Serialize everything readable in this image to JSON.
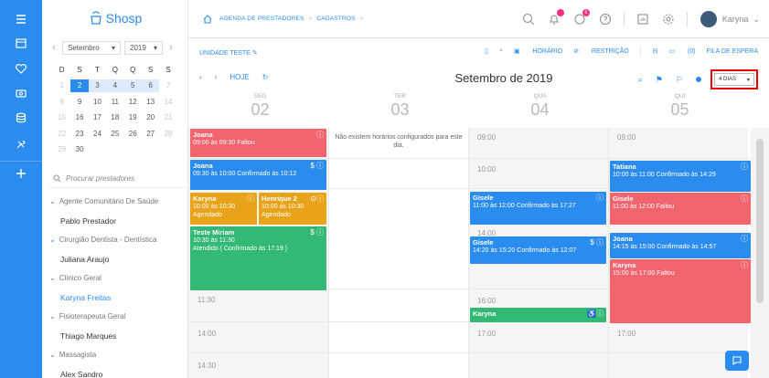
{
  "app": {
    "logo": "Shosp"
  },
  "breadcrumb": {
    "first": "AGENDA DE PRESTADORES",
    "second": "CADASTROS"
  },
  "header": {
    "notif_count": "",
    "msg_count": "6",
    "user_name": "Karyna"
  },
  "minical": {
    "month": "Setembro",
    "year": "2019",
    "weekdays": [
      "D",
      "S",
      "T",
      "Q",
      "Q",
      "S",
      "S"
    ],
    "weeks": [
      [
        "1",
        "2",
        "3",
        "4",
        "5",
        "6",
        "7"
      ],
      [
        "8",
        "9",
        "10",
        "11",
        "12",
        "13",
        "14"
      ],
      [
        "15",
        "16",
        "17",
        "18",
        "19",
        "20",
        "21"
      ],
      [
        "22",
        "23",
        "24",
        "25",
        "26",
        "27",
        "28"
      ],
      [
        "29",
        "30",
        "",
        "",
        "",
        "",
        ""
      ]
    ]
  },
  "search": {
    "placeholder": "Procurar prestadores"
  },
  "tree": [
    {
      "group": "Agente Comunitário De Saúde",
      "items": [
        "Pablo Prestador"
      ]
    },
    {
      "group": "Cirurgião Dentista - Dentística",
      "items": [
        "Juliana Araujo"
      ]
    },
    {
      "group": "Clínico Geral",
      "items": [
        "Karyna Freitas"
      ]
    },
    {
      "group": "Fisioterapeuta Geral",
      "items": [
        "Thiago Marques"
      ]
    },
    {
      "group": "Massagista",
      "items": [
        "Alex Sandro"
      ]
    }
  ],
  "toolbar": {
    "unit": "UNIDADE TESTE",
    "horario": "HORÁRIO",
    "restricao": "RESTRIÇÃO",
    "chat_count": "(0)",
    "fila": "FILA DE ESPERA",
    "hoje": "HOJE",
    "month_title": "Setembro de 2019",
    "days_option": "4 DIAS"
  },
  "days": [
    {
      "name": "SEG",
      "num": "02"
    },
    {
      "name": "TER",
      "num": "03"
    },
    {
      "name": "QUA",
      "num": "04"
    },
    {
      "name": "QUI",
      "num": "05"
    }
  ],
  "no_hours": "Não existem horários configurados para este dia.",
  "times": {
    "mon_1130": "11:30",
    "mon_1400": "14:00",
    "mon_1430": "14:30",
    "wed_0900": "09:00",
    "wed_1000": "10:00",
    "wed_1400": "14:00",
    "wed_1600": "16:00",
    "wed_1700": "17:00",
    "thu_0900": "09:00",
    "thu_1700": "17:00"
  },
  "events": {
    "e1": {
      "name": "Joana",
      "desc": "09:00 às 09:30 Faltou"
    },
    "e2": {
      "name": "Joana",
      "desc": "09:30 às 10:00 Confirmado às 10:12"
    },
    "e3": {
      "name": "Karyna",
      "time": "10:00 às 10:30",
      "desc": "Agendado"
    },
    "e4": {
      "name": "Henrique 2",
      "time": "10:00 às 10:30",
      "desc": "Agendado"
    },
    "e5": {
      "name": "Teste Miriam",
      "time": "10:30 às 11:30",
      "desc": "Atendido ( Confirmado às 17:19 )"
    },
    "e6": {
      "name": "Gisele",
      "desc": "11:00 às 12:00 Confirmado às 17:27"
    },
    "e7": {
      "name": "Gisele",
      "desc": "14:20 às 15:20 Confirmado às 12:07"
    },
    "e8": {
      "name": "Karyna",
      "desc": ""
    },
    "e9": {
      "name": "Tatiana",
      "desc": "10:00 às 11:00 Confirmado às 14:29"
    },
    "e10": {
      "name": "Gisele",
      "desc": "11:00 às 12:00 Faltou"
    },
    "e11": {
      "name": "Joana",
      "desc": "14:15 às 15:00 Confirmado às 14:57"
    },
    "e12": {
      "name": "Karyna",
      "desc": "15:00 às 17:00 Faltou"
    }
  },
  "colors": {
    "accent": "#2b8cef",
    "red": "#f2656f",
    "yellow": "#e8a319",
    "green": "#33b876"
  }
}
